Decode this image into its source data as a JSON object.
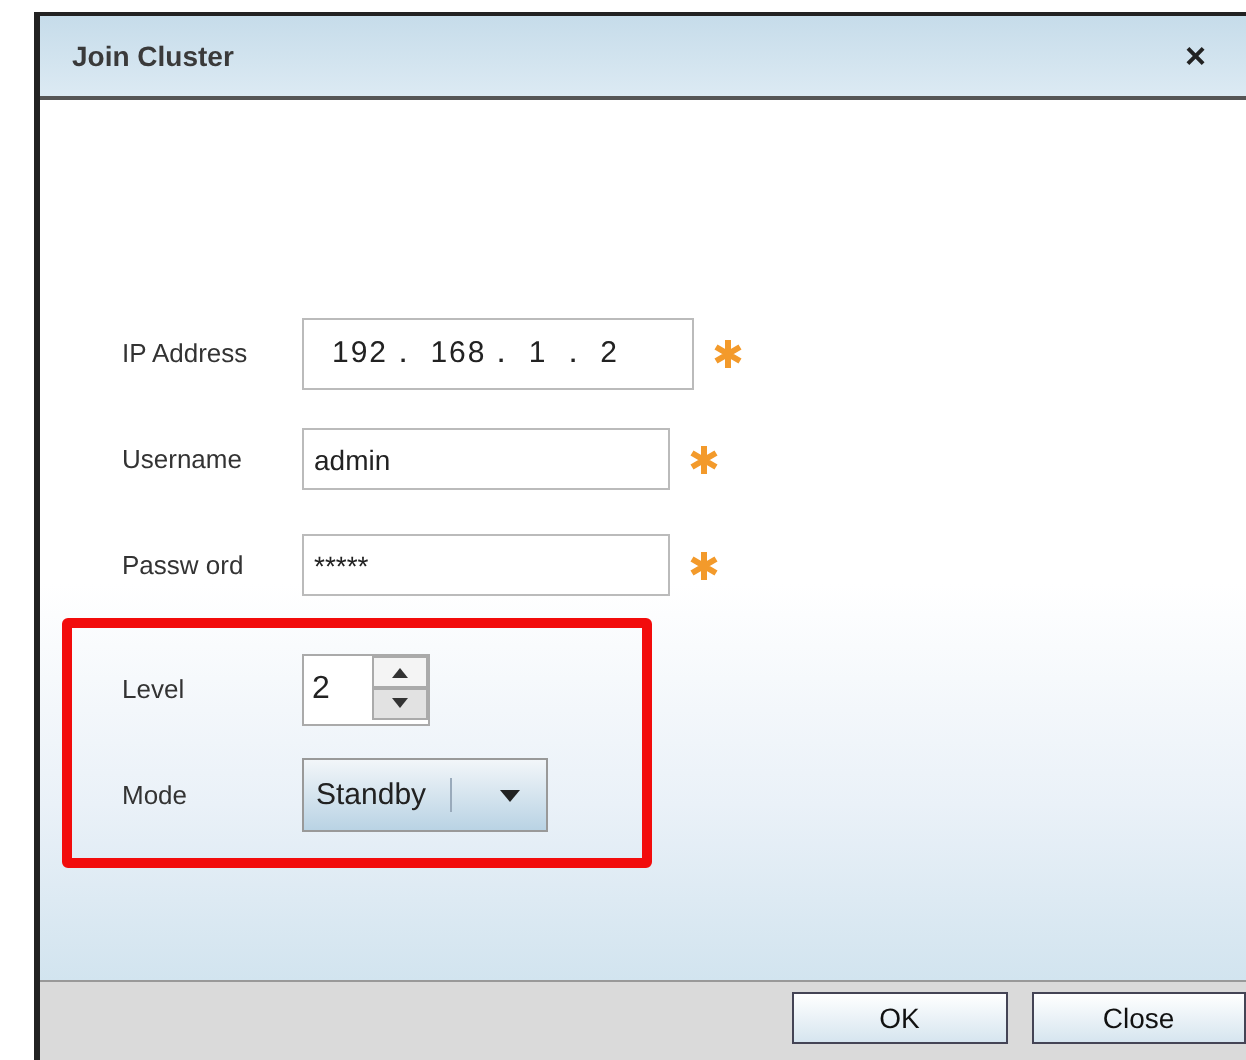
{
  "window": {
    "title": "Join Cluster",
    "close": "×"
  },
  "fields": [
    {
      "kind": "text",
      "label": "IP Address",
      "value": "192． 168． 1 ． 2",
      "required": true,
      "highlighted": false
    },
    {
      "kind": "text",
      "label": "Username",
      "value": "admin",
      "required": true,
      "highlighted": false
    },
    {
      "kind": "text",
      "label": "Passw ord",
      "value": "*****",
      "required": true,
      "highlighted": false
    },
    {
      "kind": "spinner",
      "label": "Level",
      "value": "2",
      "required": false,
      "highlighted": true
    },
    {
      "kind": "select",
      "label": "Mode",
      "value": "Standby",
      "required": false,
      "highlighted": true
    }
  ],
  "buttons": [
    "OK",
    "Close"
  ]
}
